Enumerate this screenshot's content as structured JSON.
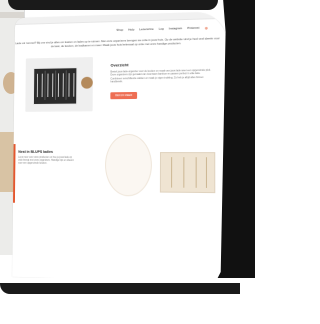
{
  "nav": {
    "items": [
      "Shop",
      "Hulp",
      "Lezerszine",
      "Log",
      "Instagram",
      "Pinterest"
    ],
    "cart_icon": "cart-icon"
  },
  "intro": {
    "text": "Lade vol rommel? Bij ons vind je alles om kasten en lades op te ruimen. Met onze organizers brengen we orde in jouw huis. Op de website vind je heel veel ideeën voor de kast, de keuken, de badkamer en meer. Maak jouw huis helemaal op orde met onze handige producten."
  },
  "overzicht": {
    "title": "Overzicht",
    "text": "Bestel jouw lade-organizer voor de keuken en maak van jouw lade weer een opgeruimde plek. Deze organizers zijn gemaakt van duurzaam bamboe en passen perfect in elke lade. Combineer verschillende vakken en maak je eigen indeling. Zo heb je altijd alles binnen handbereik.",
    "button": "BEKIJK MEER"
  },
  "info": {
    "title": "Nest in BLUPS ladies",
    "text": "Lees meer over onze producten en hoe je jouw lade op orde brengt met onze organizers. Handige tips en ideeën voor een opgeruimde keuken."
  }
}
